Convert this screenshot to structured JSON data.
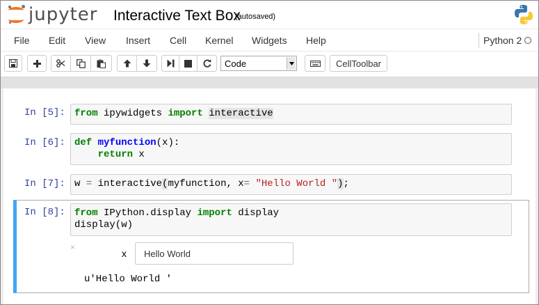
{
  "header": {
    "logo_text": "jupyter",
    "notebook_title": "Interactive Text Box",
    "autosave_status": "(autosaved)"
  },
  "menu": {
    "items": [
      "File",
      "Edit",
      "View",
      "Insert",
      "Cell",
      "Kernel",
      "Widgets",
      "Help"
    ],
    "kernel_name": "Python 2"
  },
  "toolbar": {
    "buttons": [
      "save-icon",
      "plus-icon",
      "scissors-icon",
      "copy-icon",
      "paste-icon",
      "arrow-up-icon",
      "arrow-down-icon",
      "step-forward-icon",
      "stop-icon",
      "refresh-icon",
      "keyboard-icon"
    ],
    "cell_type": "Code",
    "celltoolbar_label": "CellToolbar"
  },
  "cells": [
    {
      "prompt": "In [5]:",
      "lines": [
        "from ipywidgets import interactive"
      ]
    },
    {
      "prompt": "In [6]:",
      "lines": [
        "def myfunction(x):",
        "    return x"
      ]
    },
    {
      "prompt": "In [7]:",
      "lines": [
        "w = interactive(myfunction, x= \"Hello World \");"
      ]
    },
    {
      "prompt": "In [8]:",
      "lines": [
        "from IPython.display import display",
        "display(w)"
      ]
    }
  ],
  "widget": {
    "label": "x",
    "value": "Hello World",
    "close_glyph": "×"
  },
  "output": {
    "text": "u'Hello World '"
  },
  "colors": {
    "accent": "#f37726",
    "selected_border": "#42a5f5",
    "prompt": "#303f9f",
    "keyword": "#008000",
    "function": "#0000ff",
    "string": "#ba2121"
  }
}
